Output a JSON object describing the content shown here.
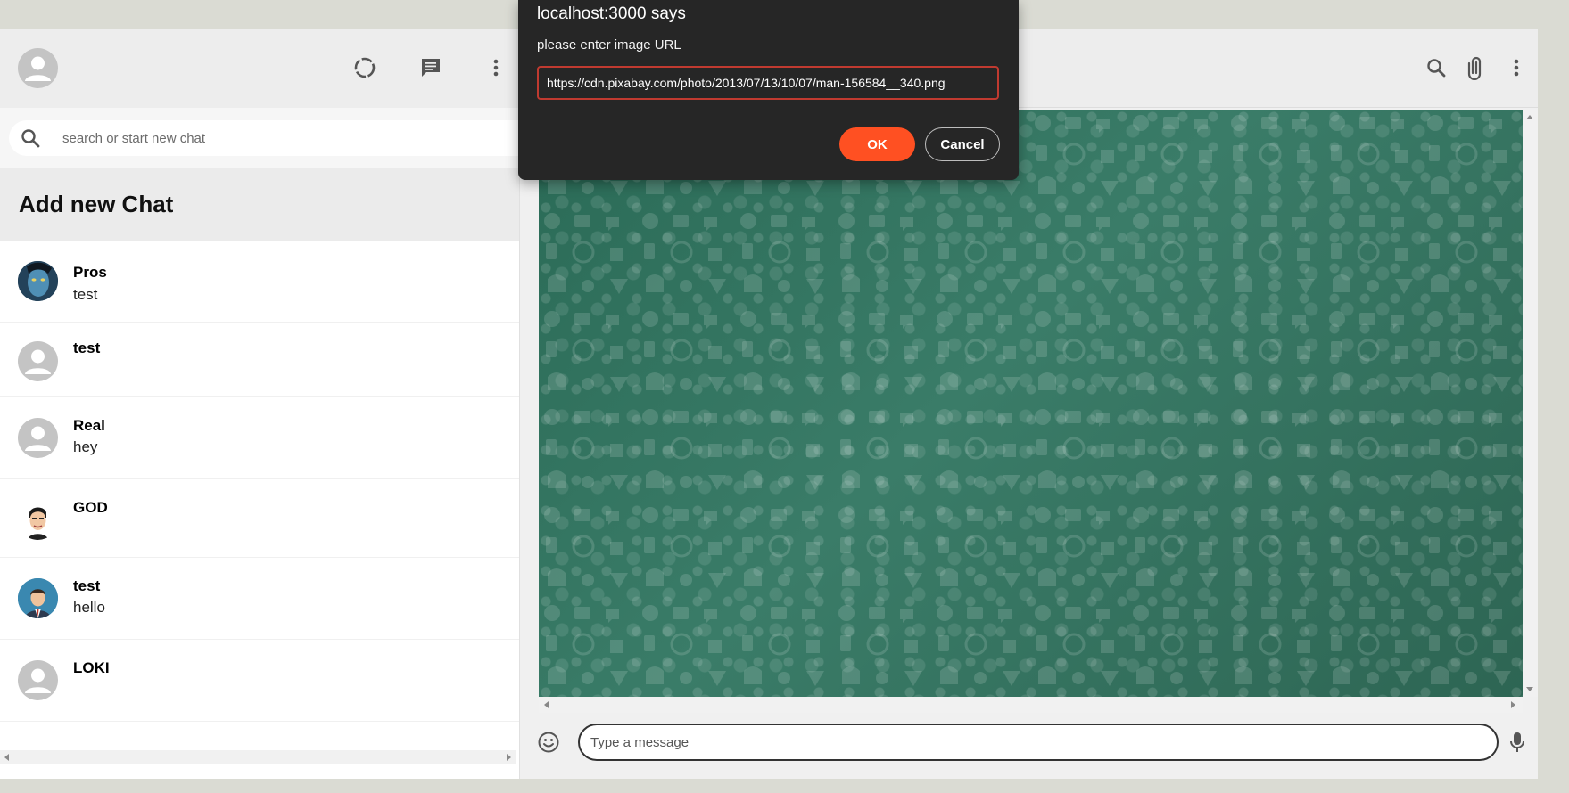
{
  "sidebar": {
    "header_icons": [
      "avatar-icon",
      "status-icon",
      "new-chat-icon",
      "menu-icon"
    ],
    "search": {
      "placeholder": "search or start new chat"
    },
    "add_new_chat": "Add new Chat",
    "chats": [
      {
        "name": "Pros",
        "last_message": "test",
        "avatar": "photo"
      },
      {
        "name": "test",
        "last_message": "",
        "avatar": "placeholder"
      },
      {
        "name": "Real",
        "last_message": "hey",
        "avatar": "placeholder"
      },
      {
        "name": "GOD",
        "last_message": "",
        "avatar": "cartoon-man"
      },
      {
        "name": "test",
        "last_message": "hello",
        "avatar": "businessman"
      },
      {
        "name": "LOKI",
        "last_message": "",
        "avatar": "placeholder"
      }
    ]
  },
  "chat": {
    "header_icons": [
      "search-icon",
      "attach-icon",
      "menu-icon"
    ],
    "composer": {
      "placeholder": "Type a message",
      "emoji_icon": "emoji-icon",
      "mic_icon": "mic-icon"
    }
  },
  "dialog": {
    "title": "localhost:3000 says",
    "message": "please enter image URL",
    "input_value": "https://cdn.pixabay.com/photo/2013/07/13/10/07/man-156584__340.png",
    "ok_label": "OK",
    "cancel_label": "Cancel"
  },
  "colors": {
    "accent_ok": "#ff5022",
    "dialog_bg": "#262626",
    "chat_bg": "#2e6a58",
    "header_bg": "#ededed"
  }
}
